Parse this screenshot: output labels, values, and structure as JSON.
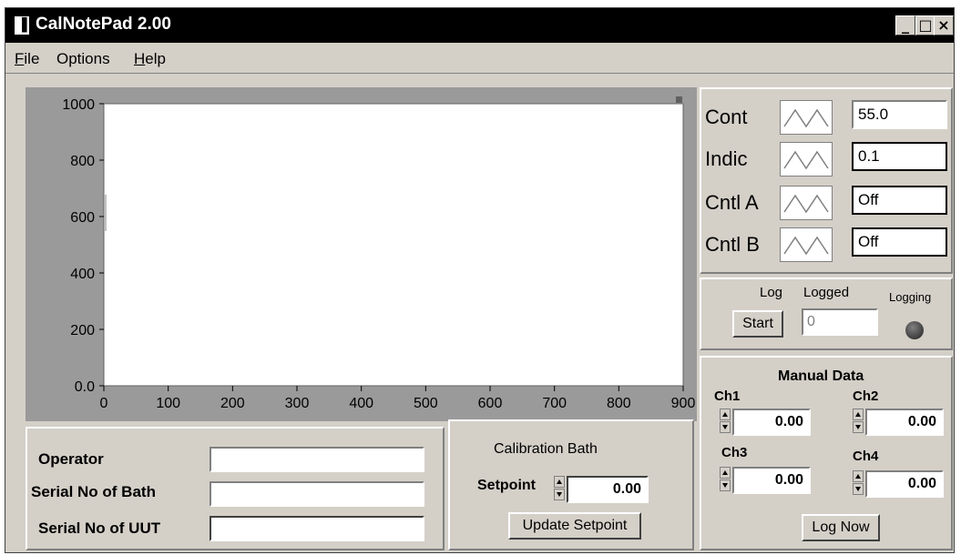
{
  "window": {
    "title": "CalNotePad 2.00",
    "minimize_glyph": "_",
    "maximize_glyph": "□",
    "close_glyph": "×"
  },
  "menu": [
    {
      "label": "File",
      "accel": "F",
      "rest": "ile"
    },
    {
      "label": "Options",
      "accel": "",
      "rest": "Options"
    },
    {
      "label": "Help",
      "accel": "H",
      "rest": "elp"
    }
  ],
  "chart_data": {
    "type": "line",
    "x_ticks": [
      "0",
      "100",
      "200",
      "300",
      "400",
      "500",
      "600",
      "700",
      "800",
      "900"
    ],
    "y_ticks": [
      "1000",
      "800",
      "600",
      "400",
      "200",
      "0.0"
    ],
    "xlim": [
      0,
      900
    ],
    "ylim": [
      0,
      1000
    ],
    "series": [],
    "grid": false,
    "plot_background": "#ffffff",
    "frame_color": "#9a9a9a"
  },
  "channels": [
    {
      "label": "Cont",
      "value": "55.0",
      "icon": "waveform-icon"
    },
    {
      "label": "Indic",
      "value": "0.1",
      "icon": "waveform-icon"
    },
    {
      "label": "Cntl A",
      "value": "Off",
      "icon": "waveform-icon"
    },
    {
      "label": "Cntl B",
      "value": "Off",
      "icon": "waveform-icon"
    }
  ],
  "logging": {
    "log_label": "Log",
    "logged_label": "Logged",
    "logging_label": "Logging",
    "start_label": "Start",
    "logged_value": "0"
  },
  "manual": {
    "title": "Manual Data",
    "channels": [
      {
        "label": "Ch1",
        "value": "0.00"
      },
      {
        "label": "Ch2",
        "value": "0.00"
      },
      {
        "label": "Ch3",
        "value": "0.00"
      },
      {
        "label": "Ch4",
        "value": "0.00"
      }
    ],
    "log_now_label": "Log Now"
  },
  "operator": {
    "operator_label": "Operator",
    "operator_value": "",
    "bath_serial_label": "Serial No of Bath",
    "bath_serial_value": "",
    "uut_serial_label": "Serial No of UUT",
    "uut_serial_value": ""
  },
  "calibration": {
    "title": "Calibration Bath",
    "setpoint_label": "Setpoint",
    "setpoint_value": "0.00",
    "update_label": "Update Setpoint"
  }
}
